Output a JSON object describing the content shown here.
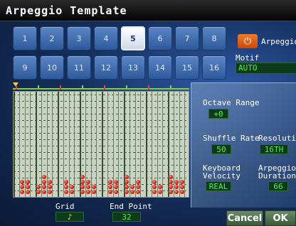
{
  "window": {
    "title": "Arpeggio Template"
  },
  "templates": {
    "buttons": [
      "1",
      "2",
      "3",
      "4",
      "5",
      "6",
      "7",
      "8",
      "9",
      "10",
      "11",
      "12",
      "13",
      "14",
      "15",
      "16"
    ],
    "selected": "5"
  },
  "arpeggio": {
    "label": "Arpeggio",
    "power_icon": "power-icon",
    "power_color": "#e8641a"
  },
  "motif": {
    "label": "Motif",
    "value": "AUTO"
  },
  "grid": {
    "label": "Grid",
    "value": "♪"
  },
  "end_point": {
    "label": "End Point",
    "value": "32"
  },
  "params": {
    "octave_range": {
      "label": "Octave Range",
      "value": "+0"
    },
    "shuffle_rate": {
      "label": "Shuffle Rate",
      "value": "50"
    },
    "resolution": {
      "label": "Resolution",
      "value": "16TH"
    },
    "keyboard_velocity": {
      "label_line1": "Keyboard",
      "label_line2": "Velocity",
      "value": "REAL"
    },
    "arpeggio_duration": {
      "label_line1": "Arpeggio",
      "label_line2": "Duration",
      "value": "66"
    }
  },
  "buttons": {
    "cancel": "Cancel",
    "ok": "OK"
  },
  "colors": {
    "field_text": "#4ef04e",
    "field_bg": "#0e3a1c",
    "note": "#c81a10",
    "accent": "#e8641a"
  }
}
